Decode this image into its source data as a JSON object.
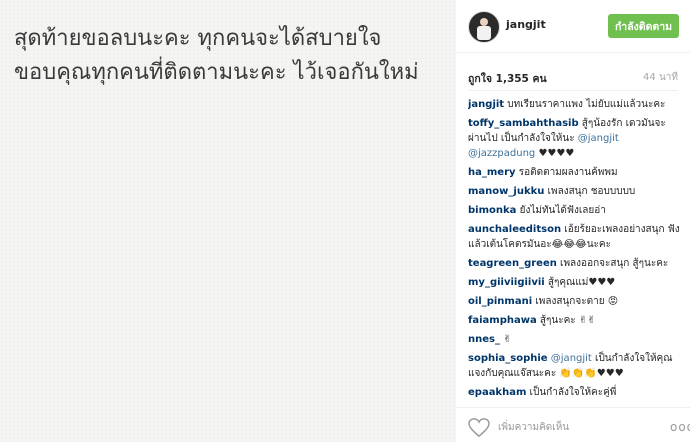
{
  "photo": {
    "line1": "สุดท้ายขอลบนะคะ ทุกคนจะได้สบายใจ",
    "line2": "ขอบคุณทุกคนที่ติดตามนะคะ ไว้เจอกันใหม่"
  },
  "header": {
    "username": "jangjit",
    "follow_label": "กำลังติดตาม"
  },
  "meta": {
    "likes": "ถูกใจ 1,355 คน",
    "time": "44 นาที"
  },
  "comments": [
    {
      "user": "jangjit",
      "text": " บทเรียนราคาแพง ไม่ยับแม่แล้วนะคะ",
      "mention": "",
      "tail": ""
    },
    {
      "user": "toffy_sambahthasib",
      "text": " สู้ๆน้องรัก เดวมันจะผ่านไป เป็นกำลังใจให้นะ ",
      "mention": "@jangjit @jazzpadung",
      "tail": " ♥♥♥♥"
    },
    {
      "user": "ha_mery",
      "text": " รอติดตามผลงานค้พพม",
      "mention": "",
      "tail": ""
    },
    {
      "user": "manow_jukku",
      "text": " เพลงสนุก ชอบบบบบ",
      "mention": "",
      "tail": ""
    },
    {
      "user": "bimonka",
      "text": " ยังไม่ทันได้ฟังเลยอ่า",
      "mention": "",
      "tail": ""
    },
    {
      "user": "aunchaleeditson",
      "text": " เอ้ยร้ยอะเพลงอย่างสนุก ฟังแล้วเต้นโคตรมันอะ😂😂😂นะคะ",
      "mention": "",
      "tail": ""
    },
    {
      "user": "teagreen_green",
      "text": " เพลงออกจะสนุก สู้ๆนะคะ",
      "mention": "",
      "tail": ""
    },
    {
      "user": "my_giiviigiivii",
      "text": " สู้ๆคุณแม่♥♥♥",
      "mention": "",
      "tail": ""
    },
    {
      "user": "oil_pinmani",
      "text": " เพลงสนุกจะตาย 😡",
      "mention": "",
      "tail": ""
    },
    {
      "user": "faiamphawa",
      "text": " สู้ๆนะคะ ✌✌",
      "mention": "",
      "tail": ""
    },
    {
      "user": "nnes_",
      "text": " ✌",
      "mention": "",
      "tail": ""
    },
    {
      "user": "sophia_sophie",
      "text": " ",
      "mention": "@jangjit",
      "tail": " เป็นกำลังใจให้คุณแจงกับคุณแจ๊สนะคะ 👏👏👏♥♥♥"
    },
    {
      "user": "epaakham",
      "text": " เป็นกำลังใจให้คะคู่พี่",
      "mention": "",
      "tail": ""
    }
  ],
  "footer": {
    "add_comment_placeholder": "เพิ่มความคิดเห็น",
    "more": "ooo"
  }
}
